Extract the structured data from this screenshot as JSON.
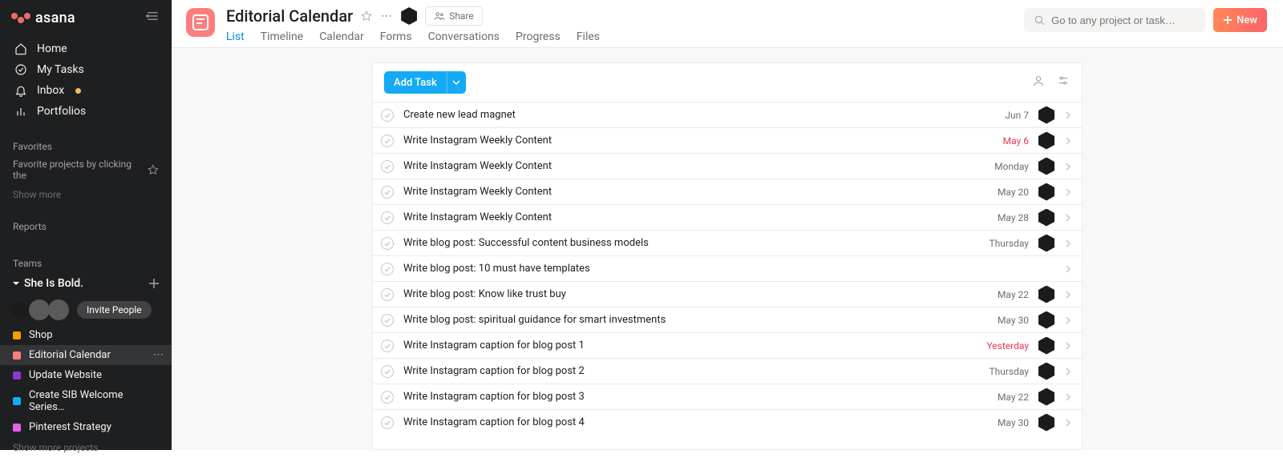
{
  "brand": {
    "name": "asana"
  },
  "sidebar": {
    "nav": [
      {
        "label": "Home",
        "icon": "home-icon"
      },
      {
        "label": "My Tasks",
        "icon": "check-circle-icon"
      },
      {
        "label": "Inbox",
        "icon": "bell-icon",
        "dot": true
      },
      {
        "label": "Portfolios",
        "icon": "bar-chart-icon"
      }
    ],
    "favorites_header": "Favorites",
    "favorites_hint": "Favorite projects by clicking the",
    "show_more": "Show more",
    "reports_header": "Reports",
    "teams_header": "Teams",
    "team_name": "She Is Bold.",
    "invite_label": "Invite People",
    "projects": [
      {
        "name": "Shop",
        "color": "#fd9a00"
      },
      {
        "name": "Editorial Calendar",
        "color": "#fd7e7e",
        "active": true
      },
      {
        "name": "Update Website",
        "color": "#8e37d2"
      },
      {
        "name": "Create SIB Welcome Series…",
        "color": "#14aaf5"
      },
      {
        "name": "Pinterest Strategy",
        "color": "#e362e3"
      }
    ],
    "show_more_projects": "Show more projects"
  },
  "header": {
    "title": "Editorial Calendar",
    "share_label": "Share",
    "tabs": [
      {
        "label": "List",
        "active": true
      },
      {
        "label": "Timeline"
      },
      {
        "label": "Calendar"
      },
      {
        "label": "Forms"
      },
      {
        "label": "Conversations"
      },
      {
        "label": "Progress"
      },
      {
        "label": "Files"
      }
    ],
    "search_placeholder": "Go to any project or task…",
    "new_label": "New"
  },
  "panel": {
    "add_task_label": "Add Task",
    "tasks": [
      {
        "name": "Create new lead magnet",
        "date": "Jun 7",
        "overdue": false,
        "assigned": true
      },
      {
        "name": "Write Instagram Weekly Content",
        "date": "May 6",
        "overdue": true,
        "assigned": true
      },
      {
        "name": "Write Instagram Weekly Content",
        "date": "Monday",
        "overdue": false,
        "assigned": true
      },
      {
        "name": "Write Instagram Weekly Content",
        "date": "May 20",
        "overdue": false,
        "assigned": true
      },
      {
        "name": "Write Instagram Weekly Content",
        "date": "May 28",
        "overdue": false,
        "assigned": true
      },
      {
        "name": "Write blog post: Successful content business models",
        "date": "Thursday",
        "overdue": false,
        "assigned": true
      },
      {
        "name": "Write blog post: 10 must have templates",
        "date": "",
        "overdue": false,
        "assigned": false
      },
      {
        "name": "Write blog post: Know like trust buy",
        "date": "May 22",
        "overdue": false,
        "assigned": true
      },
      {
        "name": "Write blog post: spiritual guidance for smart investments",
        "date": "May 30",
        "overdue": false,
        "assigned": true
      },
      {
        "name": "Write Instagram caption for blog post 1",
        "date": "Yesterday",
        "overdue": true,
        "assigned": true
      },
      {
        "name": "Write Instagram caption for blog post 2",
        "date": "Thursday",
        "overdue": false,
        "assigned": true
      },
      {
        "name": "Write Instagram caption for blog post 3",
        "date": "May 22",
        "overdue": false,
        "assigned": true
      },
      {
        "name": "Write Instagram caption for blog post 4",
        "date": "May 30",
        "overdue": false,
        "assigned": true
      }
    ]
  }
}
